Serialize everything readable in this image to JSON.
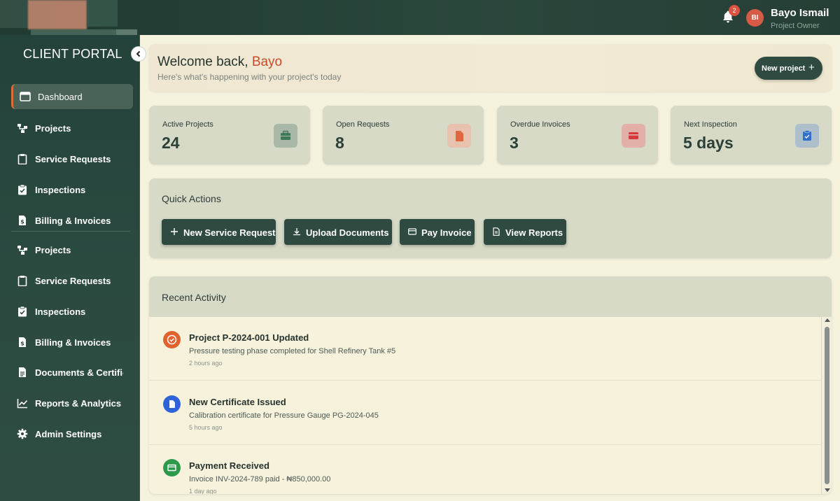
{
  "header": {
    "notification_count": "2",
    "user": {
      "initials": "BI",
      "name": "Bayo Ismail",
      "role": "Project Owner"
    }
  },
  "sidebar": {
    "title": "CLIENT PORTAL",
    "items": [
      {
        "label": "Dashboard",
        "icon": "dashboard-icon",
        "active": true
      },
      {
        "label": "Projects",
        "icon": "projects-icon"
      },
      {
        "label": "Service Requests",
        "icon": "clipboard-icon"
      },
      {
        "label": "Inspections",
        "icon": "clipboard-check-icon"
      },
      {
        "label": "Billing & Invoices",
        "icon": "invoice-icon"
      },
      {
        "label": "Projects",
        "icon": "projects-icon"
      },
      {
        "label": "Service Requests",
        "icon": "clipboard-icon"
      },
      {
        "label": "Inspections",
        "icon": "clipboard-check-icon"
      },
      {
        "label": "Billing & Invoices",
        "icon": "invoice-icon"
      },
      {
        "label": "Documents & Certificates",
        "icon": "document-icon"
      },
      {
        "label": "Reports & Analytics",
        "icon": "chart-icon"
      },
      {
        "label": "Admin Settings",
        "icon": "gear-icon"
      }
    ]
  },
  "welcome": {
    "greeting": "Welcome back, ",
    "name": "Bayo",
    "subtitle": "Here's what's happening with your project's today",
    "new_project_label": "New project",
    "new_project_icon": "+"
  },
  "stats": [
    {
      "label": "Active Projects",
      "value": "24",
      "icon": "briefcase-icon",
      "color": "#3e7a57"
    },
    {
      "label": "Open Requests",
      "value": "8",
      "icon": "file-icon",
      "color": "#e0663f"
    },
    {
      "label": "Overdue Invoices",
      "value": "3",
      "icon": "credit-card-icon",
      "color": "#d63a3a"
    },
    {
      "label": "Next Inspection",
      "value": "5 days",
      "icon": "clipboard-check-icon",
      "color": "#2f6fd1"
    }
  ],
  "quick_actions": {
    "title": "Quick Actions",
    "buttons": [
      {
        "label": "New Service Request",
        "icon": "plus-icon"
      },
      {
        "label": "Upload Documents",
        "icon": "download-icon"
      },
      {
        "label": "Pay Invoice",
        "icon": "credit-card-icon"
      },
      {
        "label": "View Reports",
        "icon": "document-icon"
      }
    ]
  },
  "recent_activity": {
    "title": "Recent Activity",
    "items": [
      {
        "title": "Project P-2024-001 Updated",
        "description": "Pressure testing phase completed for Shell Refinery Tank #5",
        "time": "2 hours ago",
        "icon": "check-circle-icon",
        "color": "#e0632e"
      },
      {
        "title": "New Certificate Issued",
        "description": "Calibration certificate for Pressure Gauge PG-2024-045",
        "time": "5 hours ago",
        "icon": "document-icon",
        "color": "#2f63d8"
      },
      {
        "title": "Payment Received",
        "description": "Invoice INV-2024-789 paid - ₦850,000.00",
        "time": "1 day ago",
        "icon": "credit-card-icon",
        "color": "#2c9a4a"
      }
    ]
  },
  "colors": {
    "accent": "#cc4a2a",
    "primary_dark": "#2f4a40",
    "sidebar_bg": "#2b4a40",
    "card_bg": "#d6dac7",
    "page_bg": "#f5f2de"
  }
}
